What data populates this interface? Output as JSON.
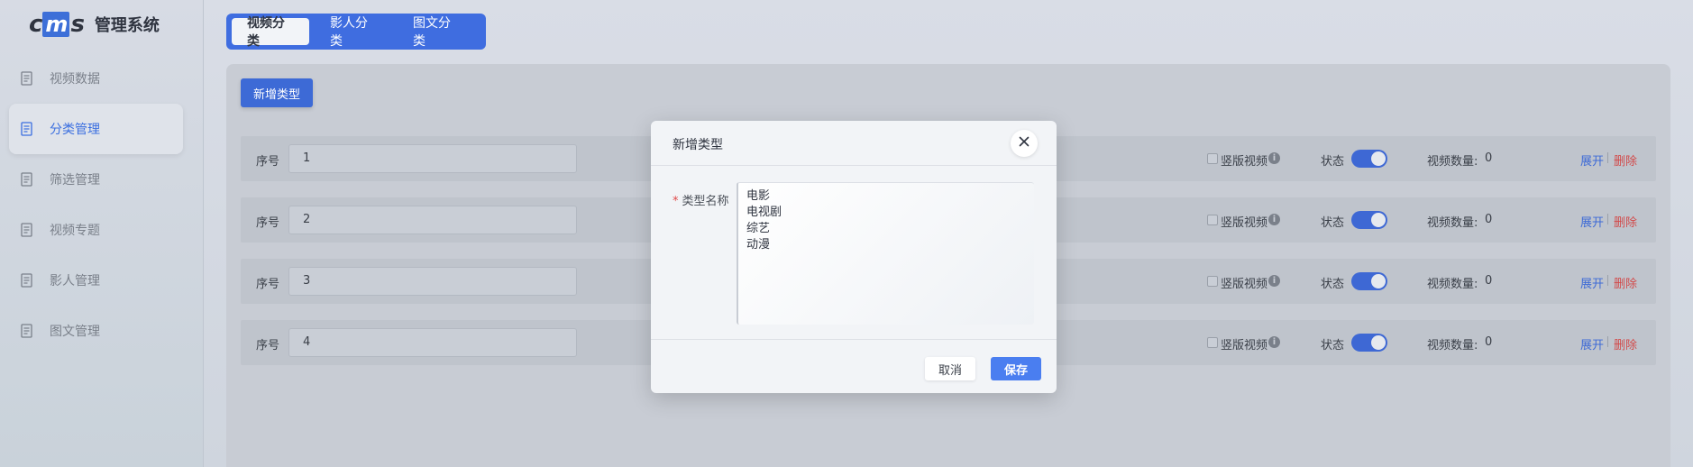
{
  "app": {
    "logo_text": "管理系统",
    "logo_mark_left": "c",
    "logo_mark_mid": "m",
    "logo_mark_right": "s"
  },
  "sidebar": {
    "items": [
      {
        "label": "视频数据",
        "icon": "document-icon",
        "active": false
      },
      {
        "label": "分类管理",
        "icon": "document-icon",
        "active": true
      },
      {
        "label": "筛选管理",
        "icon": "document-icon",
        "active": false
      },
      {
        "label": "视频专题",
        "icon": "document-icon",
        "active": false
      },
      {
        "label": "影人管理",
        "icon": "document-icon",
        "active": false
      },
      {
        "label": "图文管理",
        "icon": "document-icon",
        "active": false
      }
    ]
  },
  "tabs": [
    {
      "label": "视频分类",
      "active": true
    },
    {
      "label": "影人分类",
      "active": false
    },
    {
      "label": "图文分类",
      "active": false
    }
  ],
  "toolbar": {
    "add_label": "新增类型"
  },
  "rows": [
    {
      "seq_label": "序号",
      "seq_value": "1",
      "vertical_label": "竖版视频",
      "status_label": "状态",
      "status_on": true,
      "count_label": "视频数量:",
      "count": "0",
      "expand_label": "展开",
      "delete_label": "删除"
    },
    {
      "seq_label": "序号",
      "seq_value": "2",
      "vertical_label": "竖版视频",
      "status_label": "状态",
      "status_on": true,
      "count_label": "视频数量:",
      "count": "0",
      "expand_label": "展开",
      "delete_label": "删除"
    },
    {
      "seq_label": "序号",
      "seq_value": "3",
      "vertical_label": "竖版视频",
      "status_label": "状态",
      "status_on": true,
      "count_label": "视频数量:",
      "count": "0",
      "expand_label": "展开",
      "delete_label": "删除"
    },
    {
      "seq_label": "序号",
      "seq_value": "4",
      "vertical_label": "竖版视频",
      "status_label": "状态",
      "status_on": true,
      "count_label": "视频数量:",
      "count": "0",
      "expand_label": "展开",
      "delete_label": "删除"
    }
  ],
  "modal": {
    "title": "新增类型",
    "field_required_mark": "*",
    "field_label": "类型名称",
    "textarea_lines": [
      "电影",
      "电视剧",
      "综艺",
      "动漫"
    ],
    "cancel_label": "取消",
    "save_label": "保存"
  },
  "colors": {
    "accent": "#3f6de0",
    "danger": "#d24a4a",
    "save": "#4a7ef0"
  }
}
